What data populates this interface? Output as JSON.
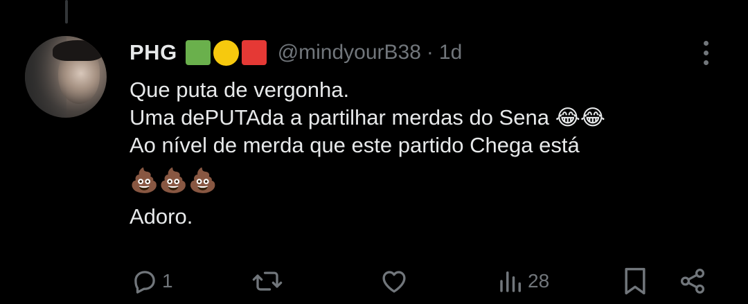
{
  "tweet": {
    "author": {
      "display_name": "PHG",
      "flag_colors": [
        "#6ab04c",
        "#f6c90e",
        "#e53935"
      ],
      "handle": "@mindyourB38",
      "separator": "·",
      "time": "1d"
    },
    "lines": [
      "Que puta de vergonha.",
      "Uma dePUTAda a partilhar merdas do Sena 😂😂",
      "Ao nível de merda que este partido Chega está",
      "💩💩💩",
      "Adoro."
    ],
    "actions": {
      "reply_count": "1",
      "views_count": "28"
    }
  },
  "icons": {
    "more": "more-vertical-icon",
    "reply": "reply-icon",
    "retweet": "retweet-icon",
    "like": "heart-icon",
    "views": "views-icon",
    "bookmark": "bookmark-icon",
    "share": "share-icon"
  },
  "colors": {
    "background": "#000000",
    "text_primary": "#e7e9ea",
    "text_secondary": "#71767b",
    "thread_line": "#333639"
  }
}
